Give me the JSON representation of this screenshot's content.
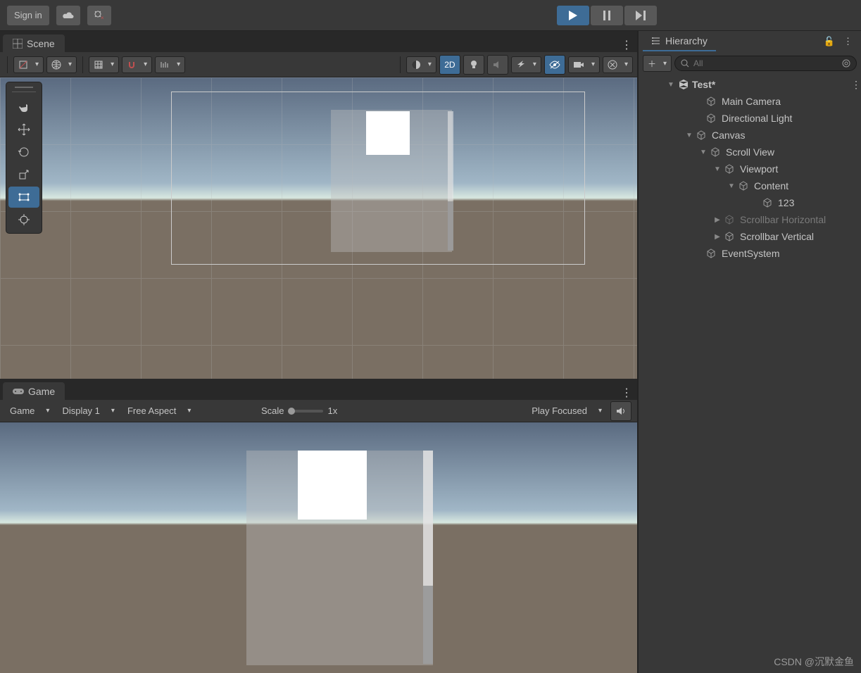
{
  "toolbar": {
    "sign_in": "Sign in"
  },
  "tabs": {
    "scene": "Scene",
    "game": "Game",
    "hierarchy": "Hierarchy"
  },
  "scene_toolbar": {
    "mode_2d": "2D"
  },
  "game_toolbar": {
    "viewmode": "Game",
    "display": "Display 1",
    "aspect": "Free Aspect",
    "scale_label": "Scale",
    "scale_value": "1x",
    "playmode": "Play Focused"
  },
  "hierarchy": {
    "search_placeholder": "All",
    "root": "Test*",
    "items": {
      "main_camera": "Main Camera",
      "dir_light": "Directional Light",
      "canvas": "Canvas",
      "scroll_view": "Scroll View",
      "viewport": "Viewport",
      "content": "Content",
      "item_123": "123",
      "scroll_h": "Scrollbar Horizontal",
      "scroll_v": "Scrollbar Vertical",
      "event_system": "EventSystem"
    }
  },
  "footer": "CSDN @沉默金鱼"
}
